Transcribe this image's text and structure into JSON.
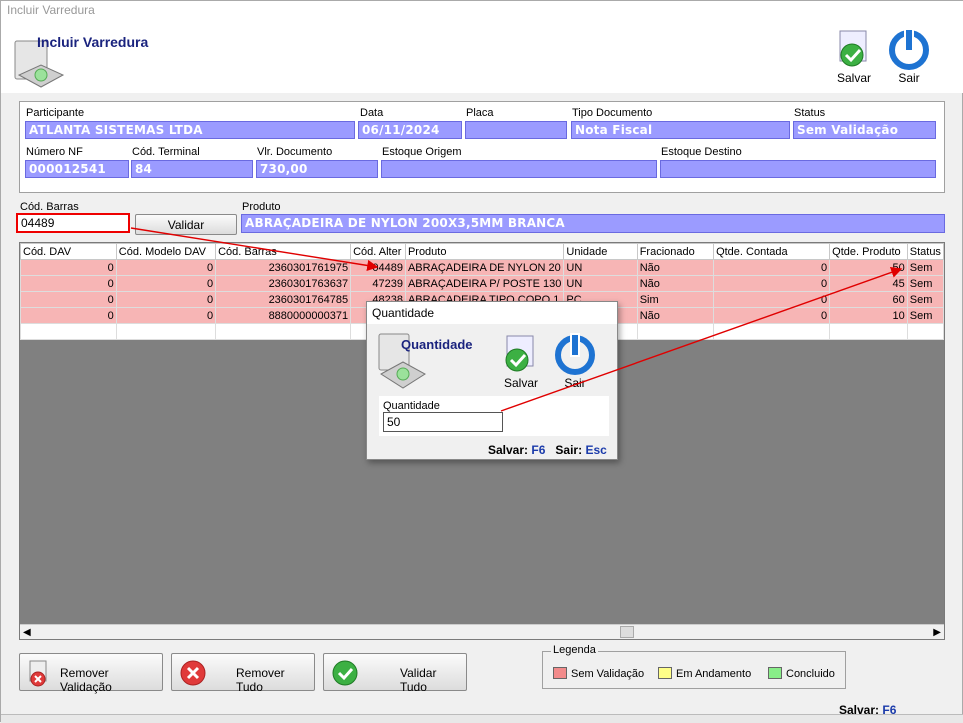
{
  "window": {
    "title": "Incluir Varredura"
  },
  "header": {
    "title": "Incluir Varredura",
    "save_label": "Salvar",
    "exit_label": "Sair"
  },
  "doc": {
    "participante_label": "Participante",
    "participante": "ATLANTA SISTEMAS LTDA",
    "data_label": "Data",
    "data": "06/11/2024",
    "placa_label": "Placa",
    "placa": "",
    "tipo_label": "Tipo Documento",
    "tipo": "Nota Fiscal",
    "status_label": "Status",
    "status": "Sem Validação",
    "nf_label": "Número NF",
    "nf": "000012541",
    "terminal_label": "Cód. Terminal",
    "terminal": "84",
    "valor_label": "Vlr. Documento",
    "valor": "730,00",
    "origem_label": "Estoque Origem",
    "origem": "",
    "destino_label": "Estoque Destino",
    "destino": ""
  },
  "scan": {
    "barras_label": "Cód. Barras",
    "barras": "04489",
    "validar_label": "Validar",
    "produto_label": "Produto",
    "produto": "ABRAÇADEIRA DE NYLON 200X3,5MM BRANCA"
  },
  "grid": {
    "columns": [
      "Cód. DAV",
      "Cód. Modelo DAV",
      "Cód. Barras",
      "Cód. Alter",
      "Produto",
      "Unidade",
      "Fracionado",
      "Qtde. Contada",
      "Qtde. Produto",
      "Status"
    ],
    "rows": [
      [
        "0",
        "0",
        "2360301761975",
        "04489",
        "ABRAÇADEIRA DE NYLON 20",
        "UN",
        "Não",
        "0",
        "50",
        "Sem"
      ],
      [
        "0",
        "0",
        "2360301763637",
        "47239",
        "ABRAÇADEIRA P/ POSTE 130",
        "UN",
        "Não",
        "0",
        "45",
        "Sem"
      ],
      [
        "0",
        "0",
        "2360301764785",
        "48238",
        "ABRAÇADEIRA TIPO COPO 1",
        "PC",
        "Sim",
        "0",
        "60",
        "Sem"
      ],
      [
        "0",
        "0",
        "8880000000371",
        "",
        "",
        "",
        "Não",
        "0",
        "10",
        "Sem"
      ]
    ]
  },
  "dialog": {
    "title": "Quantidade",
    "heading": "Quantidade",
    "save_label": "Salvar",
    "exit_label": "Sair",
    "field_label": "Quantidade",
    "field_value": "50",
    "save_hint": "Salvar:",
    "save_key": "F6",
    "exit_hint": "Sair:",
    "exit_key": "Esc"
  },
  "footer": {
    "remover_validacao": "Remover Validação",
    "remover_tudo": "Remover Tudo",
    "validar_tudo": "Validar Tudo",
    "legend_title": "Legenda",
    "legend": [
      {
        "label": "Sem Validação",
        "color": "#f28b8b"
      },
      {
        "label": "Em Andamento",
        "color": "#ffff88"
      },
      {
        "label": "Concluido",
        "color": "#88ee88"
      }
    ],
    "save_hint": "Salvar:",
    "save_key": "F6"
  },
  "colors": {
    "field_bg": "#9b9bff",
    "row_pending": "#f7b5b5",
    "arrow": "#e00000",
    "title_blue": "#1a237e"
  }
}
